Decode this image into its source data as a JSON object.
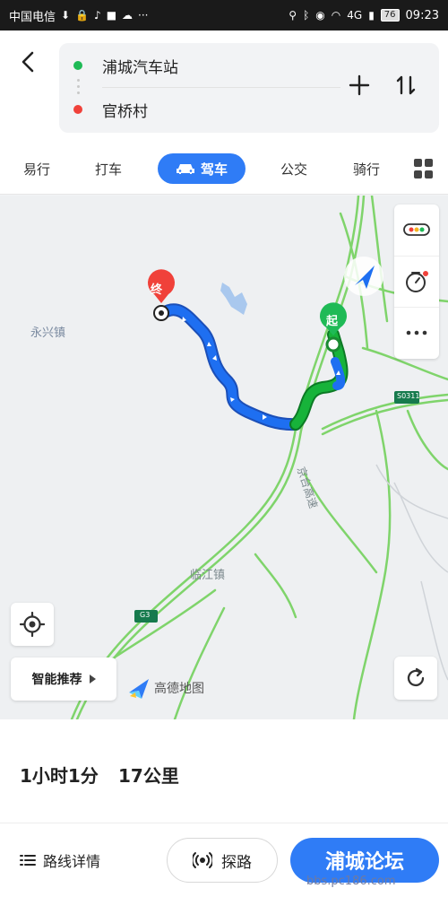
{
  "status_bar": {
    "carrier": "中国电信",
    "battery": "76",
    "time": "09:23",
    "network": "4G"
  },
  "route": {
    "start": "浦城汽车站",
    "end": "官桥村"
  },
  "tabs": [
    {
      "label": "易行",
      "active": false
    },
    {
      "label": "打车",
      "active": false
    },
    {
      "label": "驾车",
      "active": true
    },
    {
      "label": "公交",
      "active": false
    },
    {
      "label": "骑行",
      "active": false
    }
  ],
  "map": {
    "labels": {
      "town_yongxing": "永兴镇",
      "town_linjiang": "临江镇",
      "road_highway": "京台高速",
      "road_shield_s": "S0311",
      "road_shield_g": "G3"
    },
    "markers": {
      "start": "起",
      "end": "终"
    },
    "recommend_label": "智能推荐",
    "brand": "高德地图",
    "colors": {
      "route_blue": "#1e6ff1",
      "route_green": "#17b33a",
      "road_green": "#6bd15f",
      "accent": "#2f7cf6"
    }
  },
  "summary": {
    "duration": "1小时1分",
    "distance": "17公里"
  },
  "bottom": {
    "details": "路线详情",
    "explore": "探路",
    "forum": "浦城论坛",
    "watermark": "bbs.pc186.com"
  }
}
